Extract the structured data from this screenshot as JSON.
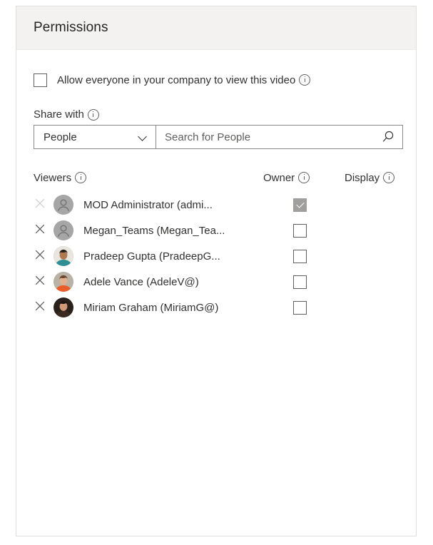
{
  "panel": {
    "title": "Permissions"
  },
  "allow_everyone": {
    "label": "Allow everyone in your company to view this video",
    "checked": false,
    "info_icon": "info-icon"
  },
  "share_with": {
    "label": "Share with",
    "info_icon": "info-icon",
    "select_value": "People",
    "select_chevron_icon": "chevron-down-icon",
    "search_placeholder": "Search for People",
    "search_value": "",
    "search_icon": "search-icon"
  },
  "table": {
    "headers": {
      "viewers": "Viewers",
      "owner": "Owner",
      "display": "Display"
    },
    "rows": [
      {
        "name": "MOD Administrator (admi...",
        "avatar_type": "placeholder",
        "owner_checked": true,
        "owner_disabled": true,
        "remove_disabled": true,
        "remove_icon": "close-icon"
      },
      {
        "name": "Megan_Teams (Megan_Tea...",
        "avatar_type": "placeholder",
        "owner_checked": false,
        "owner_disabled": false,
        "remove_disabled": false,
        "remove_icon": "close-icon"
      },
      {
        "name": "Pradeep Gupta (PradeepG...",
        "avatar_type": "photo",
        "avatar_colors": {
          "bg": "#e8e6df",
          "hair": "#2b211c",
          "skin": "#b07a50",
          "shirt": "#2e8f93"
        },
        "owner_checked": false,
        "owner_disabled": false,
        "remove_disabled": false,
        "remove_icon": "close-icon"
      },
      {
        "name": "Adele Vance (AdeleV@)",
        "avatar_type": "photo",
        "avatar_colors": {
          "bg": "#b9b2a6",
          "hair": "#6b4630",
          "skin": "#e0b090",
          "shirt": "#e85d2a"
        },
        "owner_checked": false,
        "owner_disabled": false,
        "remove_disabled": false,
        "remove_icon": "close-icon"
      },
      {
        "name": "Miriam Graham (MiriamG@)",
        "avatar_type": "photo",
        "avatar_colors": {
          "bg": "#2a211c",
          "hair": "#20150f",
          "skin": "#d09a78",
          "shirt": "#3a2a22"
        },
        "owner_checked": false,
        "owner_disabled": false,
        "remove_disabled": false,
        "remove_icon": "close-icon"
      }
    ]
  },
  "colors": {
    "header_bg": "#f3f2f1",
    "border": "#e1dfdd",
    "text": "#323130",
    "control_border": "#8a8886",
    "disabled_fill": "#a19f9d"
  }
}
